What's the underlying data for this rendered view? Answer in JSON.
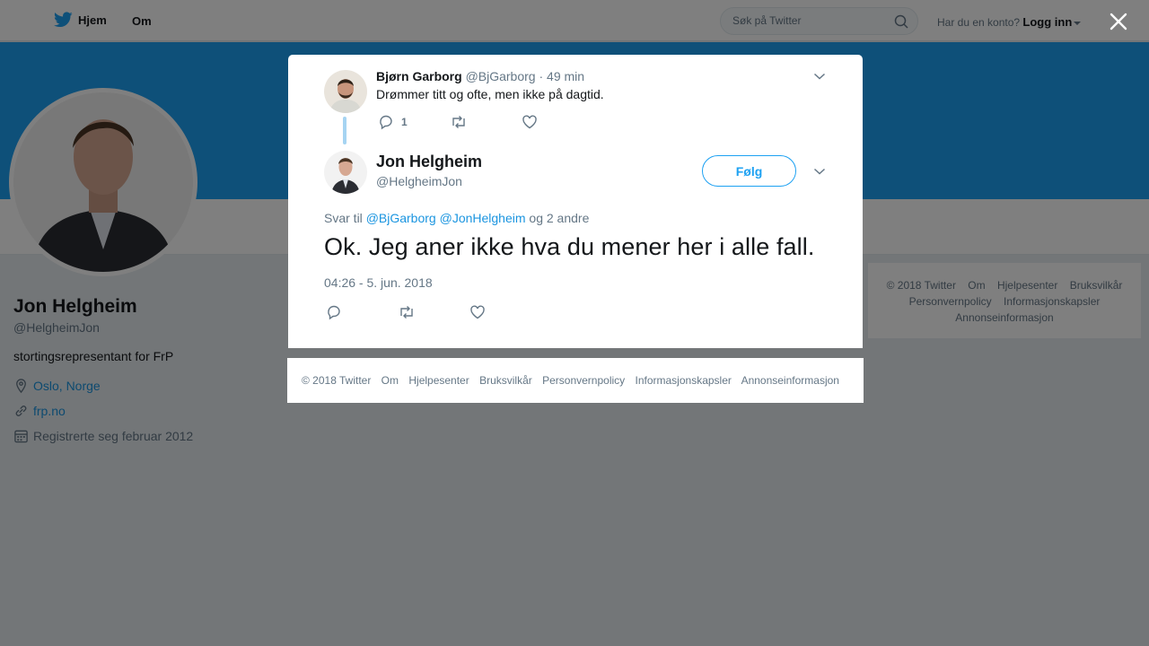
{
  "nav": {
    "home_label": "Hjem",
    "about_label": "Om",
    "search_placeholder": "Søk på Twitter",
    "account_question": "Har du en konto?",
    "login_label": "Logg inn"
  },
  "profile": {
    "name": "Jon Helgheim",
    "handle": "@HelgheimJon",
    "bio": "stortingsrepresentant for FrP",
    "location": "Oslo, Norge",
    "website": "frp.no",
    "joined": "Registrerte seg februar 2012"
  },
  "side_footer": {
    "links": [
      "© 2018 Twitter",
      "Om",
      "Hjelpesenter",
      "Bruksvilkår",
      "Personvernpolicy",
      "Informasjonskapsler",
      "Annonseinformasjon"
    ]
  },
  "parent_tweet": {
    "name": "Bjørn Garborg",
    "handle": "@BjGarborg",
    "separator": "·",
    "time": "49 min",
    "text": "Drømmer titt og ofte, men ikke på dagtid.",
    "reply_count": "1"
  },
  "main_tweet": {
    "name": "Jon Helgheim",
    "handle": "@HelgheimJon",
    "follow_label": "Følg",
    "reply_prefix": "Svar til",
    "reply_mention_1": "@BjGarborg",
    "reply_mention_2": "@JonHelgheim",
    "reply_suffix": "og 2 andre",
    "text": "Ok. Jeg aner ikke hva du mener her i alle fall.",
    "timestamp": "04:26 - 5. jun. 2018"
  },
  "modal_footer": {
    "links": [
      "© 2018 Twitter",
      "Om",
      "Hjelpesenter",
      "Bruksvilkår",
      "Personvernpolicy",
      "Informasjonskapsler",
      "Annonseinformasjon"
    ]
  },
  "colors": {
    "brand": "#1da1f2",
    "link": "#1b95e0",
    "muted": "#657786",
    "text": "#14171a"
  },
  "icons": {
    "logo": "twitter-bird-icon",
    "search": "search-icon",
    "close": "close-icon",
    "location": "location-pin-icon",
    "link": "link-icon",
    "calendar": "calendar-icon",
    "reply": "reply-icon",
    "retweet": "retweet-icon",
    "like": "heart-icon",
    "caret": "chevron-down-icon"
  }
}
